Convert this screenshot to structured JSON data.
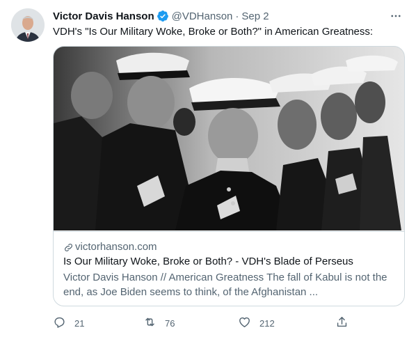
{
  "tweet": {
    "author": {
      "display_name": "Victor Davis Hanson",
      "handle": "@VDHanson",
      "verified": true,
      "verified_icon": "verified-badge-icon",
      "avatar": "author-avatar"
    },
    "separator": "·",
    "date": "Sep 2",
    "more_icon": "more-options-icon",
    "text": "VDH's \"Is Our Military Woke, Broke or Both?\" in American Greatness:"
  },
  "card": {
    "image": "marines-dress-uniform-photo",
    "domain": "victorhanson.com",
    "link_icon": "link-icon",
    "title": "Is Our Military Woke, Broke or Both? - VDH's Blade of Perseus",
    "description": "Victor Davis Hanson // American Greatness The fall of Kabul is not the end, as Joe Biden seems to think, of the Afghanistan ..."
  },
  "actions": {
    "reply": {
      "icon": "reply-icon",
      "count": "21"
    },
    "retweet": {
      "icon": "retweet-icon",
      "count": "76"
    },
    "like": {
      "icon": "like-icon",
      "count": "212"
    },
    "share": {
      "icon": "share-icon"
    }
  },
  "colors": {
    "primary_text": "#0f1419",
    "secondary_text": "#536471",
    "verified_blue": "#1d9bf0",
    "border": "#cfd9de"
  }
}
